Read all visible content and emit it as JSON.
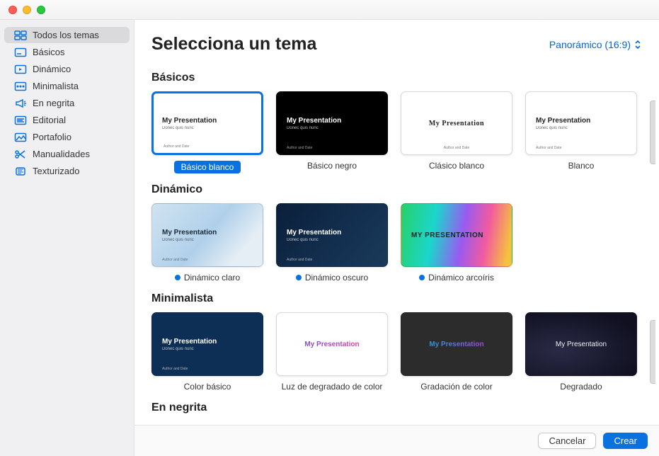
{
  "header": {
    "title": "Selecciona un tema",
    "aspect_label": "Panorámico (16:9)"
  },
  "sidebar": {
    "items": [
      {
        "label": "Todos los temas",
        "icon": "all"
      },
      {
        "label": "Básicos",
        "icon": "basic"
      },
      {
        "label": "Dinámico",
        "icon": "dynamic"
      },
      {
        "label": "Minimalista",
        "icon": "minimal"
      },
      {
        "label": "En negrita",
        "icon": "bold"
      },
      {
        "label": "Editorial",
        "icon": "editorial"
      },
      {
        "label": "Portafolio",
        "icon": "portfolio"
      },
      {
        "label": "Manualidades",
        "icon": "craft"
      },
      {
        "label": "Texturizado",
        "icon": "textured"
      }
    ],
    "selected_index": 0
  },
  "sections": {
    "basic": {
      "title": "Básicos",
      "themes": [
        {
          "name": "Básico blanco",
          "preview_title": "My Presentation",
          "preview_sub": "Donec quis nunc",
          "preview_footer": "Author and Date"
        },
        {
          "name": "Básico negro",
          "preview_title": "My Presentation",
          "preview_sub": "Donec quis nunc",
          "preview_footer": "Author and Date"
        },
        {
          "name": "Clásico blanco",
          "preview_title": "My Presentation",
          "preview_sub": "",
          "preview_footer": "Author and Date"
        },
        {
          "name": "Blanco",
          "preview_title": "My Presentation",
          "preview_sub": "Donec quis nunc",
          "preview_footer": "Author and Date"
        }
      ],
      "selected_index": 0
    },
    "dynamic": {
      "title": "Dinámico",
      "themes": [
        {
          "name": "Dinámico claro",
          "preview_title": "My Presentation",
          "preview_sub": "Donec quis nunc",
          "preview_footer": "Author and Date"
        },
        {
          "name": "Dinámico oscuro",
          "preview_title": "My Presentation",
          "preview_sub": "Donec quis nunc",
          "preview_footer": "Author and Date"
        },
        {
          "name": "Dinámico arcoíris",
          "preview_title": "MY PRESENTATION",
          "preview_sub": "",
          "preview_footer": ""
        }
      ]
    },
    "minimal": {
      "title": "Minimalista",
      "themes": [
        {
          "name": "Color básico",
          "preview_title": "My Presentation",
          "preview_sub": "Donec quis nunc",
          "preview_footer": "Author and Date"
        },
        {
          "name": "Luz de degradado de color",
          "preview_title": "My Presentation",
          "preview_sub": "",
          "preview_footer": ""
        },
        {
          "name": "Gradación de color",
          "preview_title": "My Presentation",
          "preview_sub": "",
          "preview_footer": ""
        },
        {
          "name": "Degradado",
          "preview_title": "My Presentation",
          "preview_sub": "",
          "preview_footer": ""
        }
      ]
    },
    "bold": {
      "title": "En negrita"
    }
  },
  "footer": {
    "cancel": "Cancelar",
    "create": "Crear"
  }
}
